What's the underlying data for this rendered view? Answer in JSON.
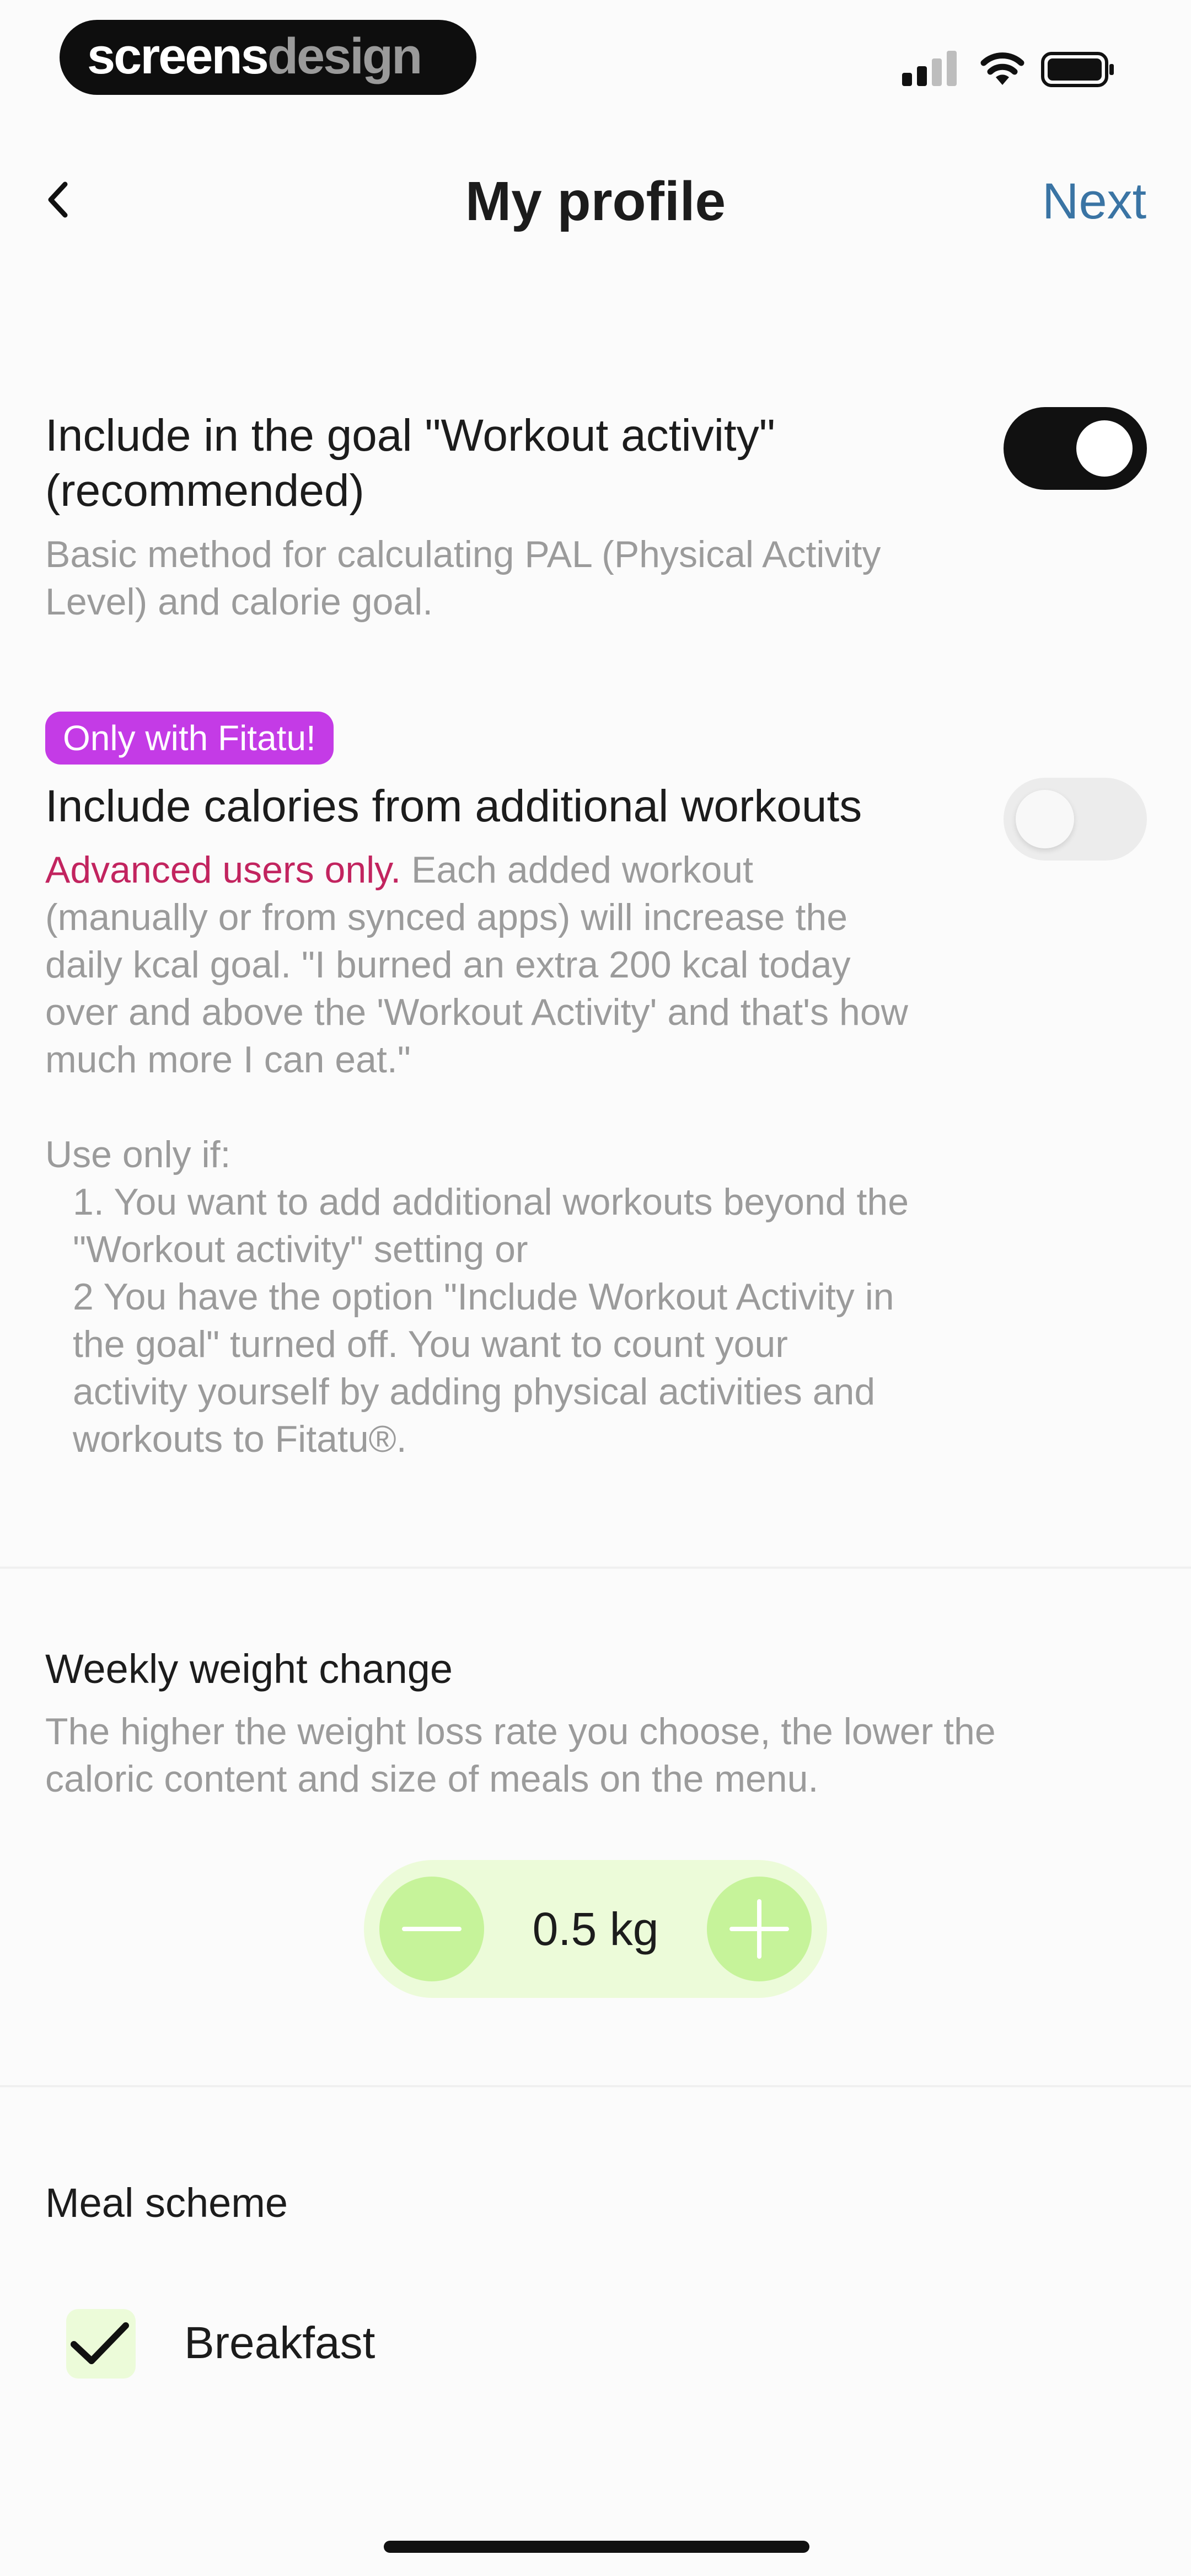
{
  "status_bar": {
    "brand_part1": "screens",
    "brand_part2": "design"
  },
  "nav": {
    "title": "My profile",
    "next_label": "Next"
  },
  "workout_activity": {
    "title_line1": "Include in the goal \"Workout activity\"",
    "title_line2": "(recommended)",
    "desc_line1": "Basic method for calculating PAL (Physical Activity",
    "desc_line2": "Level) and calorie goal.",
    "toggle_on": true
  },
  "additional_workouts": {
    "badge": "Only with Fitatu!",
    "title": "Include calories from additional workouts",
    "toggle_on": false,
    "warning": "Advanced users only.",
    "desc_line1_rest": " Each added workout",
    "desc_line2": "(manually or from synced apps) will increase the",
    "desc_line3": "daily kcal goal. \"I burned an extra 200 kcal today",
    "desc_line4": "over and above the 'Workout Activity' and that's how",
    "desc_line5": "much more I can eat.\"",
    "use_only_if": "Use only if:",
    "cond1_line1": "1. You want to add additional workouts beyond the",
    "cond1_line2": "\"Workout activity\" setting or",
    "cond2_line1": "2 You have the option \"Include Workout Activity in",
    "cond2_line2": "the goal\" turned off. You want to count your",
    "cond2_line3": "activity yourself by adding physical activities and",
    "cond2_line4": "workouts to Fitatu®."
  },
  "weekly_weight_change": {
    "title": "Weekly weight change",
    "desc_line1": "The higher the weight loss rate you choose, the lower the",
    "desc_line2": "caloric content and size of meals on the menu.",
    "value": "0.5 kg"
  },
  "meal_scheme": {
    "title": "Meal scheme",
    "items": [
      {
        "label": "Breakfast",
        "checked": true
      }
    ]
  },
  "colors": {
    "accent_link": "#3a74a4",
    "badge": "#c43be6",
    "warning": "#c2245f",
    "stepper_bg": "#ecfbd9",
    "stepper_button": "#c6f39a"
  }
}
